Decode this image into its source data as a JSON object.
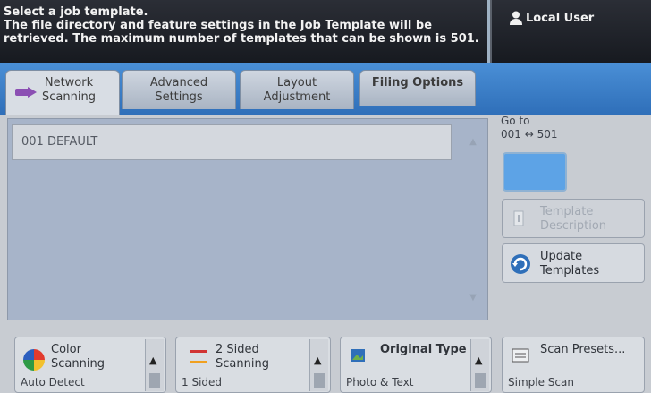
{
  "header": {
    "line1": "Select a job template.",
    "line2": "The file directory and feature settings in the Job Template will be",
    "line3": "retrieved.  The maximum number of templates that can be shown is 501."
  },
  "user": {
    "label": "Local User",
    "icon": "user-icon"
  },
  "tabs": [
    {
      "line1": "Network",
      "line2": "Scanning",
      "active": true
    },
    {
      "line1": "Advanced",
      "line2": "Settings",
      "active": false
    },
    {
      "line1": "Layout",
      "line2": "Adjustment",
      "active": false
    },
    {
      "line1": "Filing Options",
      "line2": "",
      "active": false
    }
  ],
  "list": {
    "items": [
      "001  DEFAULT"
    ]
  },
  "goto": {
    "label": "Go to",
    "range": "001 ↔ 501",
    "value": ""
  },
  "template_description": {
    "line1": "Template",
    "line2": "Description"
  },
  "update_templates": {
    "line1": "Update",
    "line2": "Templates"
  },
  "bottom": {
    "color": {
      "line1": "Color",
      "line2": "Scanning",
      "value": "Auto Detect"
    },
    "sided": {
      "line1": "2 Sided",
      "line2": "Scanning",
      "value": "1 Sided"
    },
    "original": {
      "line1": "Original Type",
      "value": "Photo & Text"
    },
    "presets": {
      "line1": "Scan Presets...",
      "value": "Simple Scan"
    }
  },
  "colors": {
    "tab_strip": "#3a7ec9",
    "goto_box": "#5da3e6",
    "header_bg": "#1f2229"
  }
}
